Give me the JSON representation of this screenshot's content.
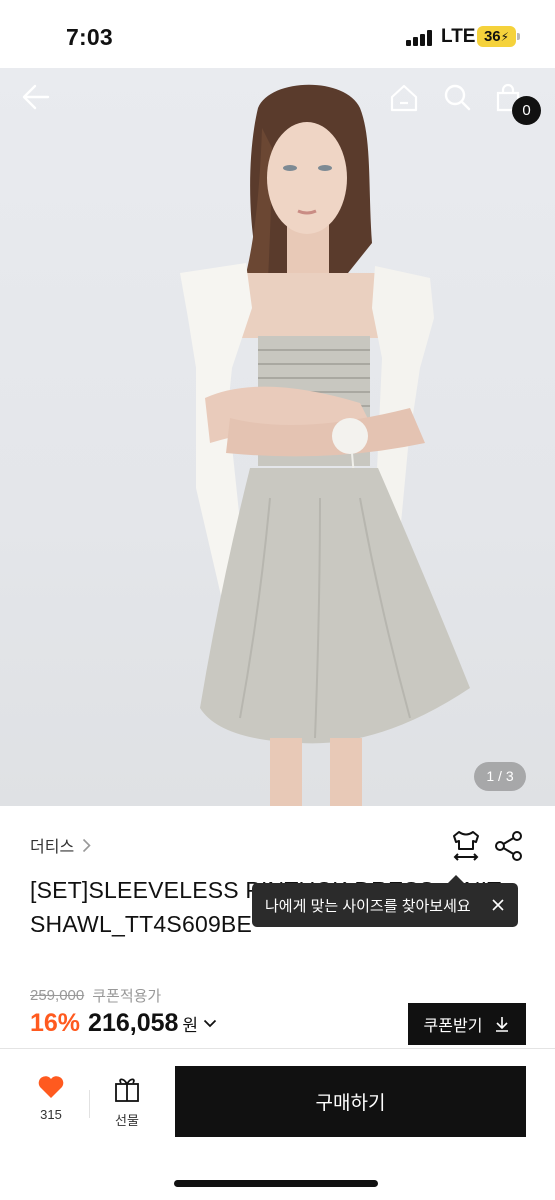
{
  "status_bar": {
    "time": "7:03",
    "network": "LTE",
    "battery": "36"
  },
  "hero": {
    "page_indicator": "1 / 3",
    "cart_count": "0",
    "icons": {
      "back": "arrow-left-icon",
      "home": "home-icon",
      "search": "search-icon",
      "cart": "shopping-bag-icon"
    }
  },
  "product": {
    "brand": "더티스",
    "title": "[SET]SLEEVELESS PINTUCK DRESS+KNIT SHAWL_TT4S609BE",
    "tooltip": "나에게 맞는 사이즈를 찾아보세요",
    "original_price": "259,000",
    "coupon_applied_label": "쿠폰적용가",
    "discount": "16%",
    "price": "216,058",
    "currency": "원",
    "coupon_button": "쿠폰받기"
  },
  "bottom_bar": {
    "like_count": "315",
    "gift_label": "선물",
    "buy_label": "구매하기"
  },
  "colors": {
    "accent": "#ff5a1f",
    "dark": "#111111",
    "battery": "#f5d23b"
  }
}
